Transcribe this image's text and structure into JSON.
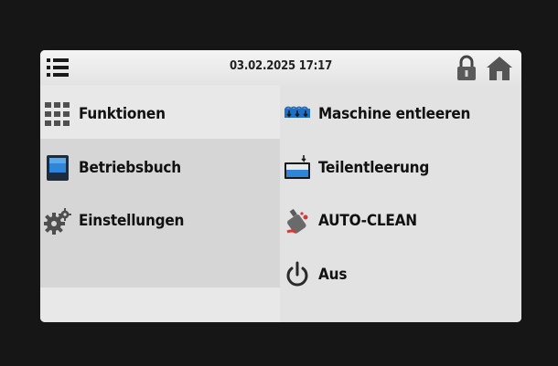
{
  "topbar": {
    "datetime": "03.02.2025 17:17",
    "menu_icon": "menu-icon",
    "lock_icon": "lock-icon",
    "home_icon": "home-icon"
  },
  "left_menu": {
    "items": [
      {
        "label": "Funktionen",
        "icon": "grid-icon"
      },
      {
        "label": "Betriebsbuch",
        "icon": "logbook-icon"
      },
      {
        "label": "Einstellungen",
        "icon": "gear-icon"
      }
    ]
  },
  "right_menu": {
    "items": [
      {
        "label": "Maschine entleeren",
        "icon": "drain-machine-icon"
      },
      {
        "label": "Teilentleerung",
        "icon": "partial-drain-icon"
      },
      {
        "label": "AUTO-CLEAN",
        "icon": "auto-clean-icon"
      },
      {
        "label": "Aus",
        "icon": "power-icon"
      }
    ]
  },
  "colors": {
    "frame": "#161616",
    "panel": "#e9e9e9",
    "selected": "#d6d6d6",
    "accent_blue": "#1f6fc5"
  }
}
